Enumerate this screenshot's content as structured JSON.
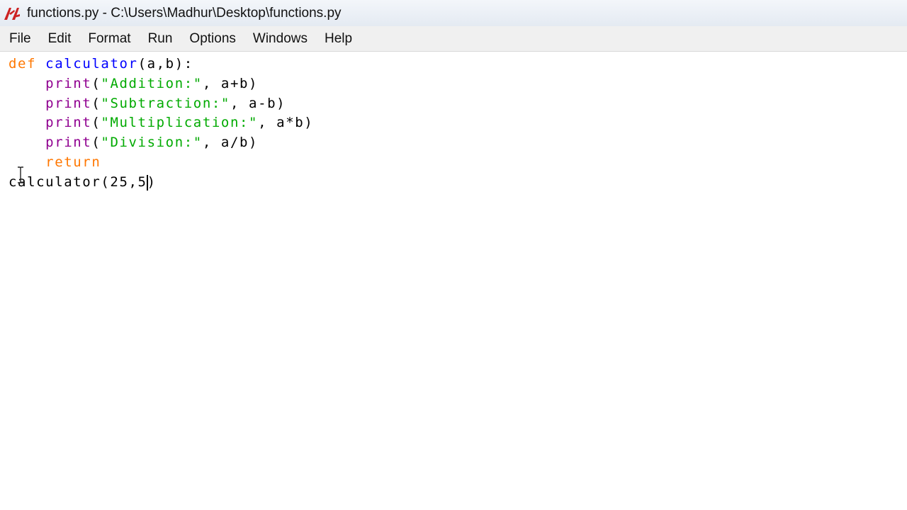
{
  "window": {
    "title": "functions.py - C:\\Users\\Madhur\\Desktop\\functions.py",
    "app_icon": "tk-feather-icon"
  },
  "menu": {
    "items": [
      {
        "id": "file",
        "label": "File"
      },
      {
        "id": "edit",
        "label": "Edit"
      },
      {
        "id": "format",
        "label": "Format"
      },
      {
        "id": "run",
        "label": "Run"
      },
      {
        "id": "options",
        "label": "Options"
      },
      {
        "id": "windows",
        "label": "Windows"
      },
      {
        "id": "help",
        "label": "Help"
      }
    ]
  },
  "editor": {
    "lines": [
      {
        "kw": "def",
        "sp": " ",
        "name": "calculator",
        "rest": "(a,b):"
      },
      {
        "indent": "    ",
        "fn": "print",
        "open": "(",
        "str": "\"Addition:\"",
        "rest": ", a+b)"
      },
      {
        "indent": "    ",
        "fn": "print",
        "open": "(",
        "str": "\"Subtraction:\"",
        "rest": ", a-b)"
      },
      {
        "indent": "    ",
        "fn": "print",
        "open": "(",
        "str": "\"Multiplication:\"",
        "rest": ", a*b)"
      },
      {
        "indent": "    ",
        "fn": "print",
        "open": "(",
        "str": "\"Division:\"",
        "rest": ", a/b)"
      },
      {
        "indent": "    ",
        "kw": "return"
      },
      {
        "before_caret": "calculator(25,5",
        "after_caret": ")"
      }
    ]
  },
  "colors": {
    "keyword": "#ff7700",
    "definition": "#0000ff",
    "string": "#00aa00",
    "builtin": "#900090",
    "default": "#000000"
  }
}
